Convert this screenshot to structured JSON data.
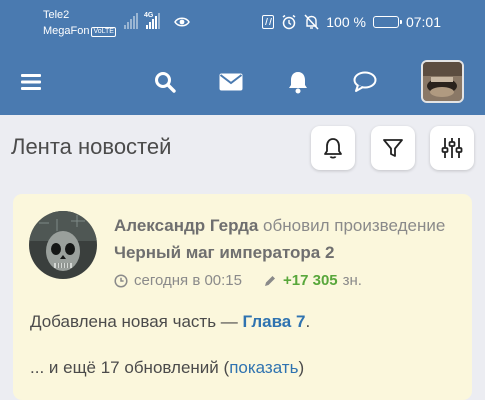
{
  "status_bar": {
    "carrier1": "Tele2",
    "carrier2": "MegaFon",
    "volte_badge": "VoLTE",
    "network": "4G",
    "battery": "100 %",
    "time": "07:01"
  },
  "header": {
    "icons": [
      "menu-icon",
      "search-icon",
      "mail-icon",
      "bell-icon",
      "chat-icon"
    ],
    "color": "#4a7ab0"
  },
  "feed": {
    "title": "Лента новостей",
    "buttons": [
      "notifications",
      "filter",
      "settings"
    ]
  },
  "post": {
    "author": "Александр Герда",
    "action": "обновил произведение",
    "work_title": "Черный маг императора 2",
    "time": "сегодня в 00:15",
    "chars_added": "+17 305",
    "chars_unit": "зн.",
    "body_prefix": "Добавлена новая часть —",
    "chapter": "Глава 7",
    "body_suffix": ".",
    "more_prefix": "... и ещё 17 обновлений (",
    "more_link": "показать",
    "more_suffix": ")"
  },
  "colors": {
    "accent": "#2f73b0",
    "positive": "#58a73b",
    "card_bg": "#fbf7dc"
  }
}
